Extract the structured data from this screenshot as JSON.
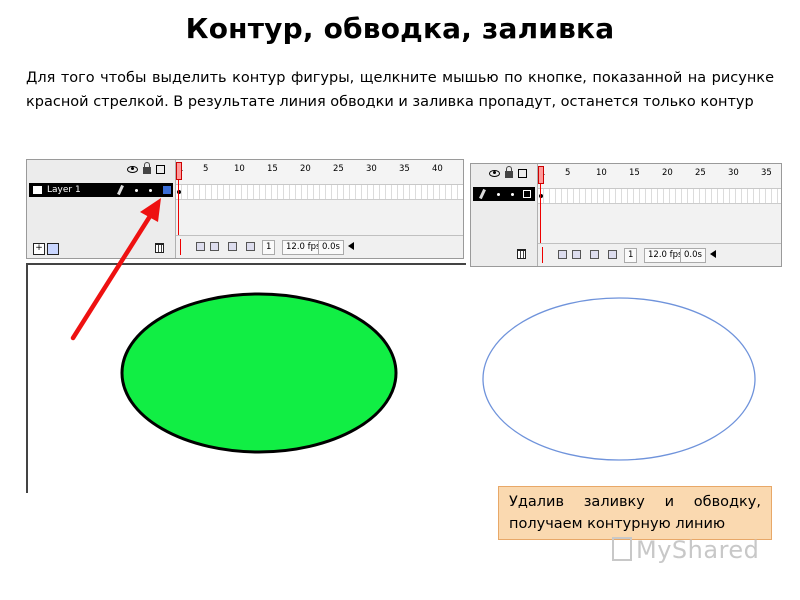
{
  "title": "Контур, обводка, заливка",
  "description": "Для того чтобы выделить контур фигуры, щелкните мышью по кнопке, показанной на рисунке красной стрелкой. В результате линия обводки и заливка пропадут, останется только контур",
  "timeline_left": {
    "layer_name": "Layer 1",
    "ruler_numbers": [
      "1",
      "5",
      "10",
      "15",
      "20",
      "25",
      "30",
      "35",
      "40"
    ],
    "current_frame": "1",
    "fps": "12.0 fps",
    "time": "0.0s"
  },
  "timeline_right": {
    "ruler_numbers": [
      "1",
      "5",
      "10",
      "15",
      "20",
      "25",
      "30",
      "35"
    ],
    "current_frame": "1",
    "fps": "12.0 fps",
    "time": "0.0s"
  },
  "colors": {
    "fill": "#11ee44",
    "stroke": "#000000",
    "outline": "#6f93db",
    "arrow": "#ee1111"
  },
  "caption": "Удалив заливку и обводку, получаем контурную линию",
  "watermark": "MyShared"
}
